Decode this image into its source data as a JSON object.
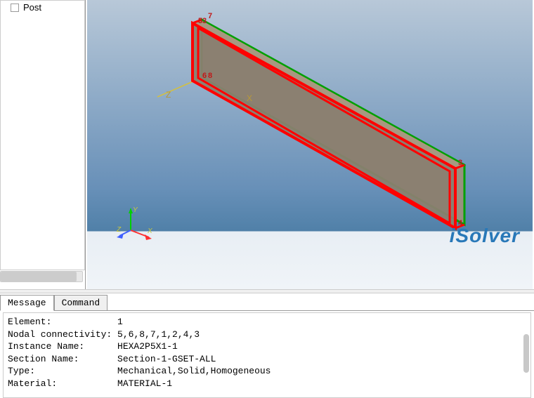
{
  "sidebar": {
    "items": [
      {
        "label": "Post"
      }
    ]
  },
  "viewport": {
    "axis_labels": {
      "x": "X",
      "y": "Y",
      "z": "Z"
    },
    "node_labels": [
      "7",
      "5",
      "3",
      "6",
      "8",
      "3",
      "4"
    ],
    "brand": "iSolver",
    "triad": {
      "x": "X",
      "y": "Y",
      "z": "Z"
    }
  },
  "tabs": [
    {
      "label": "Message",
      "active": true
    },
    {
      "label": "Command",
      "active": false
    }
  ],
  "console": {
    "lines": [
      {
        "key": "Element:",
        "value": "1"
      },
      {
        "key": "Nodal connectivity:",
        "value": "5,6,8,7,1,2,4,3"
      },
      {
        "key": "Instance Name:",
        "value": "HEXA2P5X1-1"
      },
      {
        "key": "Section Name:",
        "value": "Section-1-GSET-ALL"
      },
      {
        "key": "Type:",
        "value": "Mechanical,Solid,Homogeneous"
      },
      {
        "key": "Material:",
        "value": "MATERIAL-1"
      }
    ]
  }
}
